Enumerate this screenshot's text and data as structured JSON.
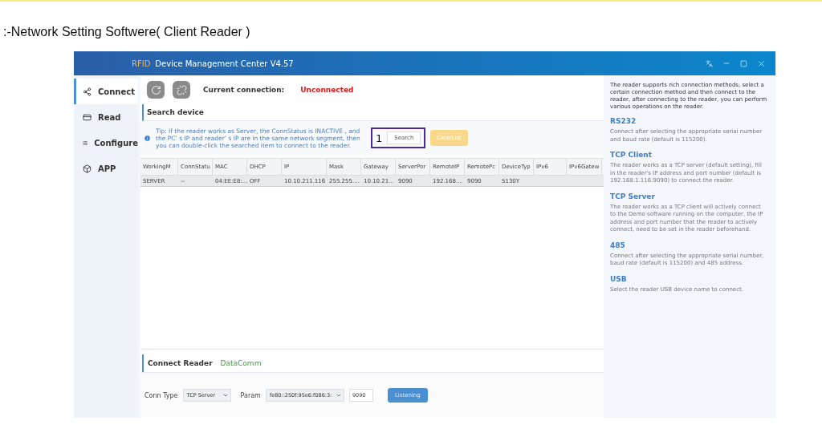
{
  "page_title": ":-Network Setting Softwere( Client Reader )",
  "window": {
    "brand": "RFID",
    "title": "Device Management Center V4.57"
  },
  "sidebar": {
    "items": [
      {
        "label": "Connect",
        "selected": true
      },
      {
        "label": "Read",
        "selected": false
      },
      {
        "label": "Configure",
        "selected": false
      },
      {
        "label": "APP",
        "selected": false
      }
    ]
  },
  "connection": {
    "label": "Current connection:",
    "status": "Unconnected"
  },
  "search_section": {
    "title": "Search device",
    "tip": "Tip: If the reader works as Server, the ConnStatus is INACTIVE , and the PC’ s IP and reader’ s IP are in the same network segment, then you can double-click the searched item to connect to the reader.",
    "annotation": "1",
    "search_button": "Search",
    "clear_button": "ClearList"
  },
  "table": {
    "columns": [
      "WorkingM",
      "ConnStatu",
      "MAC",
      "DHCP",
      "IP",
      "Mask",
      "Gateway",
      "ServerPor",
      "RemoteIP",
      "RemotePc",
      "DeviceTyp",
      "IPv6",
      "IPv6Gatew"
    ],
    "rows": [
      {
        "selected": true,
        "cells": [
          "SERVER",
          "--",
          "04:EE:E8:...",
          "OFF",
          "10.10.211.116",
          "255.255....",
          "10.10.21...",
          "9090",
          "192.168....",
          "9090",
          "S130Y",
          "",
          ""
        ]
      }
    ]
  },
  "connect_reader": {
    "title": "Connect Reader",
    "tab": "DataComm",
    "conn_type_label": "Conn Type",
    "conn_type": "TCP Server",
    "param_label": "Param",
    "param": "fe80::250f:95e6:f086:3:",
    "port": "9090",
    "button": "Listening"
  },
  "help": {
    "intro": "The reader supports rich connection methods, select a certain connection method and then connect to the reader, after connecting to the reader, you can perform various operations on the reader.",
    "sections": [
      {
        "title": "RS232",
        "text": "Connect after selecting the appropriate serial number and baud rate (default is 115200)."
      },
      {
        "title": "TCP Client",
        "text": "The reader works as a TCP server (default setting), fill in the reader's IP address and port number (default is 192.168.1.116:9090) to connect the reader."
      },
      {
        "title": "TCP Server",
        "text": "The reader works as a TCP client will actively connect to the Demo software running on the computer, the IP address and port number that the reader to actively connect, need  to be set in the reader beforehand."
      },
      {
        "title": "485",
        "text": "Connect after selecting the appropriate serial number, baud rate (default is 115200) and 485 address."
      },
      {
        "title": "USB",
        "text": "Select the reader USB device name to connect."
      }
    ]
  }
}
